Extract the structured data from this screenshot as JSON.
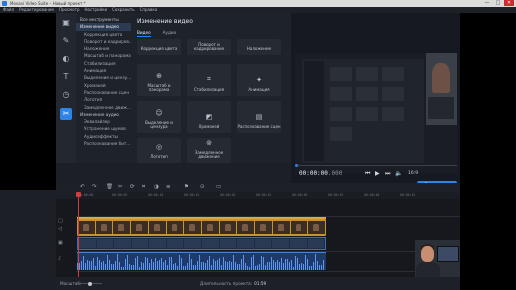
{
  "window": {
    "title": "Movavi Video Suite – Новый проект *",
    "controls": [
      "—",
      "□",
      "✕"
    ]
  },
  "menu": [
    "Файл",
    "Редактирование",
    "Просмотр",
    "Настройки",
    "Сохранить",
    "Справка"
  ],
  "toolstrip": [
    {
      "icon": "import-icon",
      "glyph": "▣"
    },
    {
      "icon": "magic-wand-icon",
      "glyph": "✎"
    },
    {
      "icon": "filters-icon",
      "glyph": "◐"
    },
    {
      "icon": "titles-icon",
      "glyph": "T"
    },
    {
      "icon": "stickers-icon",
      "glyph": "◷"
    },
    {
      "icon": "tools-icon",
      "glyph": "✂",
      "active": true
    }
  ],
  "categories": [
    {
      "label": "Все инструменты",
      "group": true
    },
    {
      "label": "Изменение видео",
      "group": true,
      "selected": true
    },
    {
      "label": "Коррекция цвета"
    },
    {
      "label": "Поворот и кадриров..."
    },
    {
      "label": "Наложение"
    },
    {
      "label": "Масштаб и панорама"
    },
    {
      "label": "Стабилизация"
    },
    {
      "label": "Анимация"
    },
    {
      "label": "Выделение и цензу..."
    },
    {
      "label": "Хромакей"
    },
    {
      "label": "Распознавание сцен"
    },
    {
      "label": "Логотип"
    },
    {
      "label": "Замедленное движ..."
    },
    {
      "label": "Изменение аудио",
      "group": true
    },
    {
      "label": "Эквалайзер"
    },
    {
      "label": "Устранение шумов"
    },
    {
      "label": "Аудиоэффекты"
    },
    {
      "label": "Распознавание бит..."
    }
  ],
  "panel": {
    "title": "Изменение видео",
    "tabs": [
      "Видео",
      "Аудио"
    ],
    "tiles": [
      {
        "label": "Коррекция цвета",
        "glyph": ""
      },
      {
        "label": "Поворот и кадрирование",
        "glyph": ""
      },
      {
        "label": "Наложение",
        "glyph": ""
      },
      {
        "label": "Масштаб и панорама",
        "glyph": "⊕"
      },
      {
        "label": "Стабилизация",
        "glyph": "⌗"
      },
      {
        "label": "Анимация",
        "glyph": "✦"
      },
      {
        "label": "Выделение и цензура",
        "glyph": "☺"
      },
      {
        "label": "Хромакей",
        "glyph": "◩"
      },
      {
        "label": "Распознавание сцен",
        "glyph": "▤"
      },
      {
        "label": "Логотип",
        "glyph": "◎"
      },
      {
        "label": "Замедленное движение",
        "glyph": "⊚"
      }
    ]
  },
  "preview": {
    "timecode": "00:00:00",
    "timecode_ms": ".000",
    "aspect_ratio": "16:9",
    "save_label": "Сохранить"
  },
  "timeline": {
    "ruler": [
      "00:00:00",
      "00:00:05",
      "00:00:10",
      "00:00:15",
      "00:00:20",
      "00:00:25",
      "00:00:30",
      "00:00:35",
      "00:00:40",
      "00:00:45"
    ]
  },
  "status": {
    "zoom_label": "Масштаб:",
    "duration_label": "Длительность проекта:",
    "duration_value": "01:59"
  }
}
